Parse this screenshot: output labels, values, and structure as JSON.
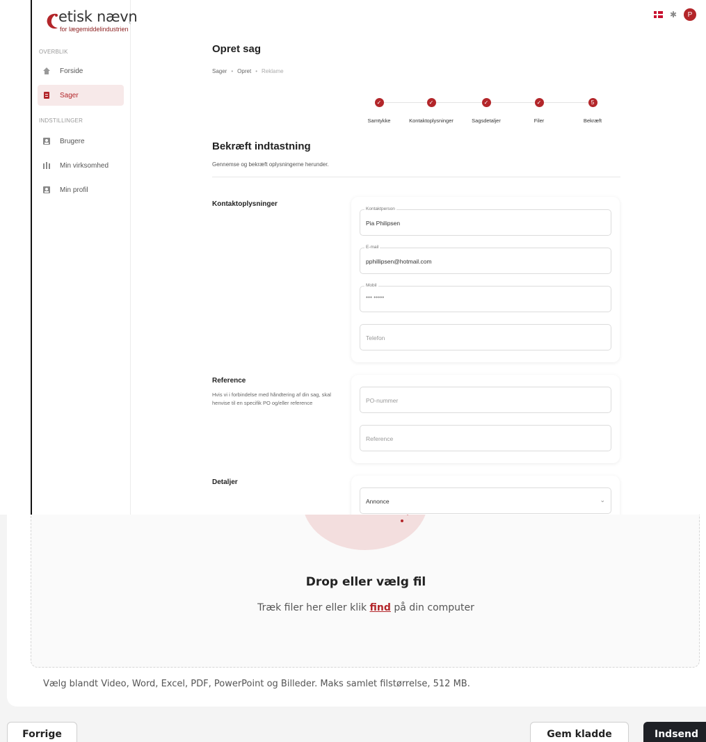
{
  "brand": {
    "name": "etisk nævn",
    "subtitle": "for lægemiddelindustrien"
  },
  "sidebar": {
    "sections": [
      {
        "label": "OVERBLIK",
        "items": [
          {
            "label": "Forside",
            "icon": "home-icon"
          },
          {
            "label": "Sager",
            "icon": "document-icon",
            "active": true
          }
        ]
      },
      {
        "label": "INDSTILLINGER",
        "items": [
          {
            "label": "Brugere",
            "icon": "user-icon"
          },
          {
            "label": "Min virksomhed",
            "icon": "building-icon"
          },
          {
            "label": "Min profil",
            "icon": "profile-icon"
          }
        ]
      }
    ]
  },
  "topbar": {
    "language": "Danish flag",
    "avatar_initial": "P"
  },
  "page": {
    "title": "Opret sag",
    "breadcrumb": [
      "Sager",
      "Opret",
      "Reklame"
    ]
  },
  "stepper": {
    "steps": [
      {
        "label": "Samtykke",
        "state": "done"
      },
      {
        "label": "Kontaktoplysninger",
        "state": "done"
      },
      {
        "label": "Sagsdetaljer",
        "state": "done"
      },
      {
        "label": "Filer",
        "state": "done"
      },
      {
        "label": "Bekræft",
        "state": "current",
        "number": "5"
      }
    ]
  },
  "confirm": {
    "title": "Bekræft indtastning",
    "subtitle": "Gennemse og bekræft oplysningerne herunder."
  },
  "contact": {
    "title": "Kontaktoplysninger",
    "fields": {
      "contact_person": {
        "label": "Kontaktperson",
        "value": "Pia Philipsen"
      },
      "email": {
        "label": "E-mail",
        "value": "pphillipsen@hotmail.com"
      },
      "mobile": {
        "label": "Mobil",
        "value": "••• •••••"
      },
      "phone": {
        "placeholder": "Telefon"
      }
    }
  },
  "reference": {
    "title": "Reference",
    "description": "Hvis vi i forbindelse med håndtering af din sag, skal henvise til en specifik PO og/eller reference",
    "po_placeholder": "PO-nummer",
    "reference_placeholder": "Reference"
  },
  "details": {
    "title": "Detaljer",
    "select_value": "Annonce"
  },
  "upload": {
    "title": "Drop eller vælg fil",
    "subtitle_before": "Træk filer her eller klik ",
    "link": "find",
    "subtitle_after": " på din computer",
    "note": "Vælg blandt Video, Word, Excel, PDF, PowerPoint og Billeder. Maks samlet filstørrelse, 512 MB."
  },
  "buttons": {
    "prev": "Forrige",
    "draft": "Gem kladde",
    "submit": "Indsend"
  },
  "colors": {
    "accent": "#b3262a",
    "dark_button": "#1f2126",
    "active_bg": "#f7e9e9"
  }
}
